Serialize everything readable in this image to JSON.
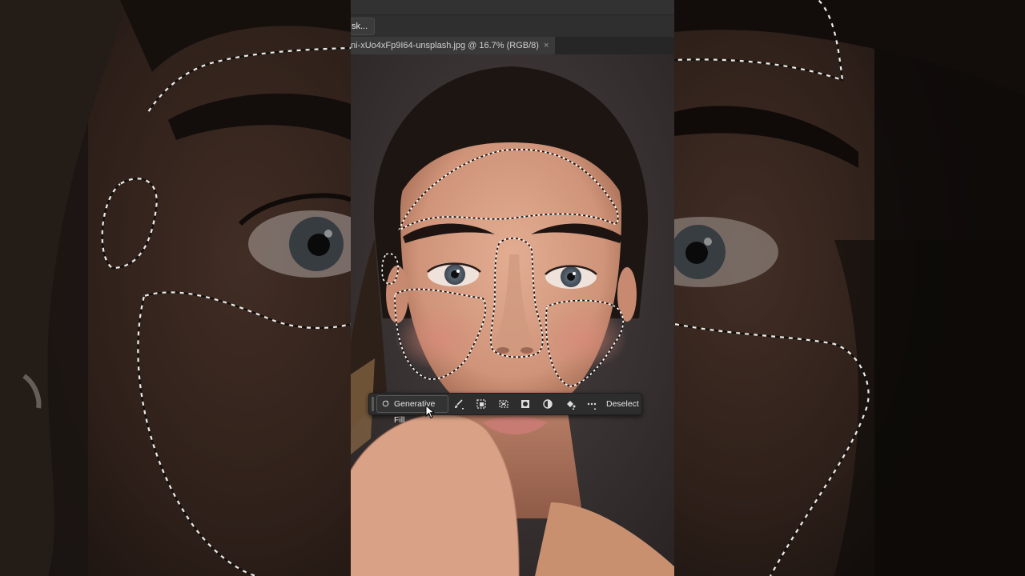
{
  "options_bar": {
    "mask_button_label": "sk..."
  },
  "document_tab": {
    "title": "ni-xUo4xFp9I64-unsplash.jpg @ 16.7% (RGB/8)",
    "close_glyph": "×"
  },
  "contextual_task_bar": {
    "generative_fill_label": "Generative Fill",
    "deselect_label": "Deselect",
    "tools": [
      "brush-icon",
      "modify-selection-icon",
      "transform-selection-icon",
      "mask-icon",
      "adjustment-icon",
      "fill-icon",
      "more-options-icon"
    ]
  },
  "colors": {
    "ui_dark": "#2b2b2b",
    "taskbar_bg": "#2d2d2d",
    "skin": "#d9a287",
    "hair": "#1e1714",
    "background": "#3a3434"
  }
}
